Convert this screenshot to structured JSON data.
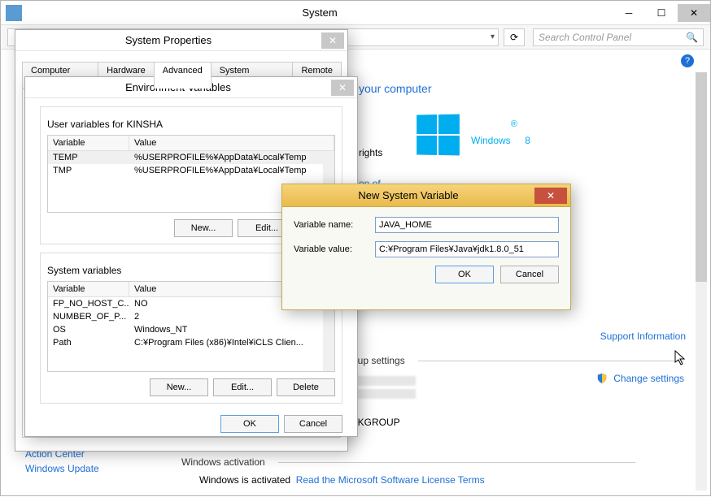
{
  "main": {
    "title": "System",
    "search_placeholder": "Search Control Panel",
    "heading_fragment": "your computer",
    "rights": "rights",
    "on_of": "on of",
    "windows8": "Windows",
    "windows8_sup": "®",
    "windows8_num": "8",
    "support_info": "Support Information",
    "group_settings": "oup settings",
    "change_settings": "Change settings",
    "workgroup": "RKGROUP",
    "activation_legend": "Windows activation",
    "activation_text": "Windows is activated",
    "license_link": "Read the Microsoft Software License Terms",
    "action_center": "Action Center",
    "windows_update": "Windows Update"
  },
  "sysprops": {
    "title": "System Properties",
    "tabs": [
      "Computer Name",
      "Hardware",
      "Advanced",
      "System Protection",
      "Remote"
    ],
    "active_tab": 2
  },
  "env": {
    "title": "Environment Variables",
    "user_label": "User variables for KINSHA",
    "sys_label": "System variables",
    "col_var": "Variable",
    "col_val": "Value",
    "user_vars": [
      {
        "name": "TEMP",
        "value": "%USERPROFILE%¥AppData¥Local¥Temp"
      },
      {
        "name": "TMP",
        "value": "%USERPROFILE%¥AppData¥Local¥Temp"
      }
    ],
    "sys_vars": [
      {
        "name": "FP_NO_HOST_C...",
        "value": "NO"
      },
      {
        "name": "NUMBER_OF_P...",
        "value": "2"
      },
      {
        "name": "OS",
        "value": "Windows_NT"
      },
      {
        "name": "Path",
        "value": "C:¥Program Files (x86)¥Intel¥iCLS Clien..."
      }
    ],
    "new": "New...",
    "edit": "Edit...",
    "delete": "Delete",
    "ok": "OK",
    "cancel": "Cancel"
  },
  "newvar": {
    "title": "New System Variable",
    "name_label": "Variable name:",
    "value_label": "Variable value:",
    "name_value": "JAVA_HOME",
    "value_value": "C:¥Program Files¥Java¥jdk1.8.0_51",
    "ok": "OK",
    "cancel": "Cancel"
  }
}
